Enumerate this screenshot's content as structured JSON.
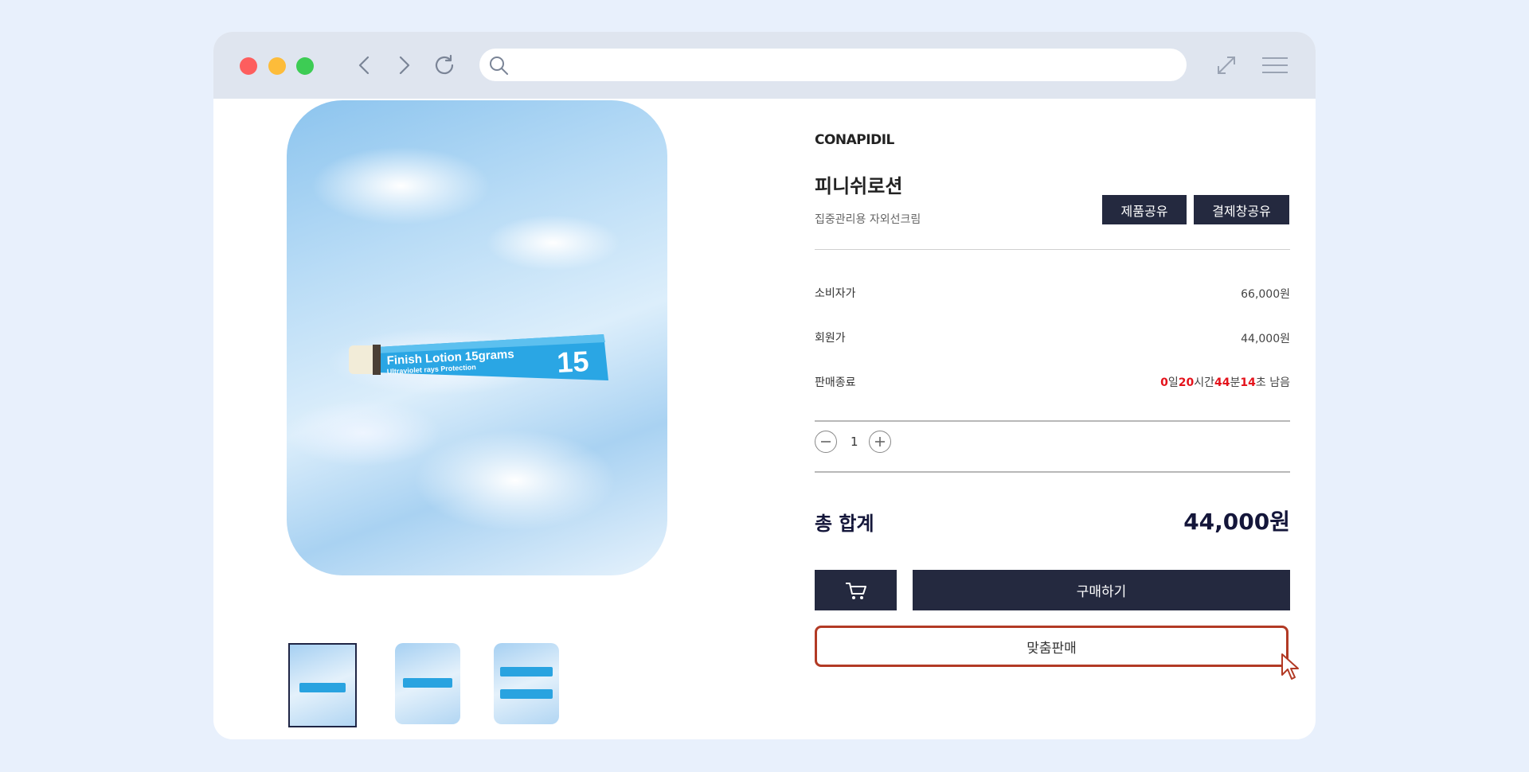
{
  "browser": {
    "address": "",
    "icons": [
      "chevron-left-icon",
      "chevron-right-icon",
      "reload-icon",
      "search-icon",
      "expand-icon",
      "menu-icon"
    ]
  },
  "product": {
    "brand": "CONAPIDIL",
    "name": "피니쉬로션",
    "subtitle": "집중관리용 자외선크림",
    "share_button": "제품공유",
    "checkout_share_button": "결제창공유",
    "consumer_price_label": "소비자가",
    "consumer_price": "66,000원",
    "member_price_label": "회원가",
    "member_price": "44,000원",
    "sale_end_label": "판매종료",
    "countdown": {
      "days": "0",
      "days_unit": "일",
      "hours": "20",
      "hours_unit": "시간",
      "minutes": "44",
      "minutes_unit": "분",
      "seconds": "14",
      "seconds_unit": "초 남음"
    },
    "quantity": "1",
    "total_label": "총 합계",
    "total_value": "44,000원",
    "buy_button": "구매하기",
    "custom_sale_button": "맞춤판매",
    "image_text": {
      "title": "Finish Lotion 15grams",
      "subtitle": "Ultraviolet rays Protection",
      "number": "15"
    }
  },
  "colors": {
    "accent_dark": "#24293f",
    "countdown_red": "#e4121b",
    "highlight_border": "#b23a25"
  }
}
